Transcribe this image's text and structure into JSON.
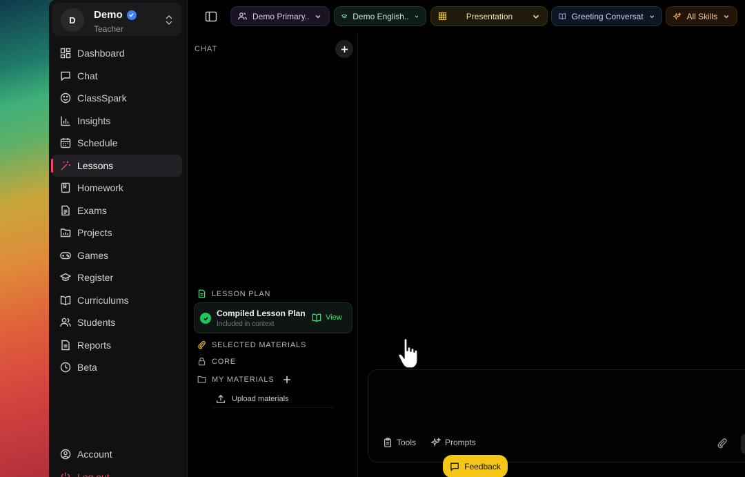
{
  "profile": {
    "initial": "D",
    "name": "Demo",
    "role": "Teacher"
  },
  "nav": {
    "items": [
      {
        "label": "Dashboard",
        "icon": "dashboard-icon"
      },
      {
        "label": "Chat",
        "icon": "chat-icon"
      },
      {
        "label": "ClassSpark",
        "icon": "smiley-icon"
      },
      {
        "label": "Insights",
        "icon": "bar-chart-icon"
      },
      {
        "label": "Schedule",
        "icon": "calendar-icon"
      },
      {
        "label": "Lessons",
        "icon": "magic-wand-icon",
        "active": true
      },
      {
        "label": "Homework",
        "icon": "notebook-icon"
      },
      {
        "label": "Exams",
        "icon": "document-icon"
      },
      {
        "label": "Projects",
        "icon": "folder-icon"
      },
      {
        "label": "Games",
        "icon": "gamepad-icon"
      },
      {
        "label": "Register",
        "icon": "graduation-cap-icon"
      },
      {
        "label": "Curriculums",
        "icon": "book-open-icon"
      },
      {
        "label": "Students",
        "icon": "users-icon"
      },
      {
        "label": "Reports",
        "icon": "report-icon"
      },
      {
        "label": "Beta",
        "icon": "clock-icon"
      }
    ],
    "bottom": [
      {
        "label": "Account",
        "icon": "user-circle-icon"
      },
      {
        "label": "Log out",
        "icon": "logout-icon"
      }
    ]
  },
  "topbar": {
    "class_pill": "Demo Primary..",
    "subject_pill": "Demo English..",
    "type_pill": "Presentation",
    "topic_pill": "Greeting Conversat",
    "skills_pill": "All Skills"
  },
  "chat_panel": {
    "header": "CHAT",
    "lesson_plan_heading": "LESSON PLAN",
    "lesson_card_title": "Compiled Lesson Plan",
    "lesson_card_sub": "Included in context",
    "lesson_card_action": "View",
    "selected_materials": "SELECTED MATERIALS",
    "core": "CORE",
    "my_materials": "MY MATERIALS",
    "upload": "Upload materials"
  },
  "composer": {
    "tools": "Tools",
    "prompts": "Prompts"
  },
  "feedback_label": "Feedback",
  "colors": {
    "accent_active": "#ef4466",
    "feedback_bg": "#f5c518",
    "success": "#22c55e"
  }
}
